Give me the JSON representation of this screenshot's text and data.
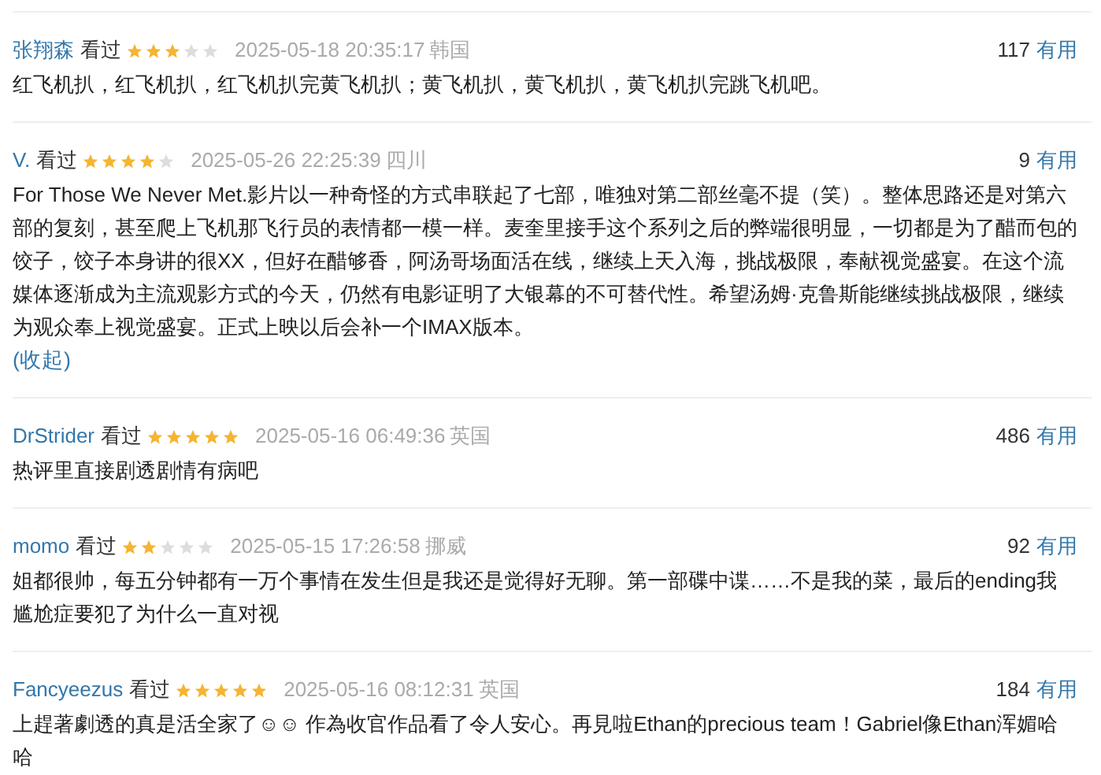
{
  "reviews": [
    {
      "user": "张翔森",
      "status": "看过",
      "stars": 3,
      "time": "2025-05-18 20:35:17",
      "location": "韩国",
      "votes": "117",
      "useful": "有用",
      "body": "红飞机扒，红飞机扒，红飞机扒完黄飞机扒；黄飞机扒，黄飞机扒，黄飞机扒完跳飞机吧。"
    },
    {
      "user": "V.",
      "status": "看过",
      "stars": 4,
      "time": "2025-05-26 22:25:39",
      "location": "四川",
      "votes": "9",
      "useful": "有用",
      "body": "For Those We Never Met.影片以一种奇怪的方式串联起了七部，唯独对第二部丝毫不提（笑）。整体思路还是对第六部的复刻，甚至爬上飞机那飞行员的表情都一模一样。麦奎里接手这个系列之后的弊端很明显，一切都是为了醋而包的饺子，饺子本身讲的很XX，但好在醋够香，阿汤哥场面活在线，继续上天入海，挑战极限，奉献视觉盛宴。在这个流媒体逐渐成为主流观影方式的今天，仍然有电影证明了大银幕的不可替代性。希望汤姆·克鲁斯能继续挑战极限，继续为观众奉上视觉盛宴。正式上映以后会补一个IMAX版本。",
      "collapse": "(收起)"
    },
    {
      "user": "DrStrider",
      "status": "看过",
      "stars": 5,
      "time": "2025-05-16 06:49:36",
      "location": "英国",
      "votes": "486",
      "useful": "有用",
      "body": "热评里直接剧透剧情有病吧"
    },
    {
      "user": "momo",
      "status": "看过",
      "stars": 2,
      "time": "2025-05-15 17:26:58",
      "location": "挪威",
      "votes": "92",
      "useful": "有用",
      "body": "姐都很帅，每五分钟都有一万个事情在发生但是我还是觉得好无聊。第一部碟中谍……不是我的菜，最后的ending我尴尬症要犯了为什么一直对视"
    },
    {
      "user": "Fancyeezus",
      "status": "看过",
      "stars": 5,
      "time": "2025-05-16 08:12:31",
      "location": "英国",
      "votes": "184",
      "useful": "有用",
      "body": "上趕著劇透的真是活全家了☺☺ 作為收官作品看了令人安心。再見啦Ethan的precious team！Gabriel像Ethan浑媚哈哈"
    }
  ]
}
